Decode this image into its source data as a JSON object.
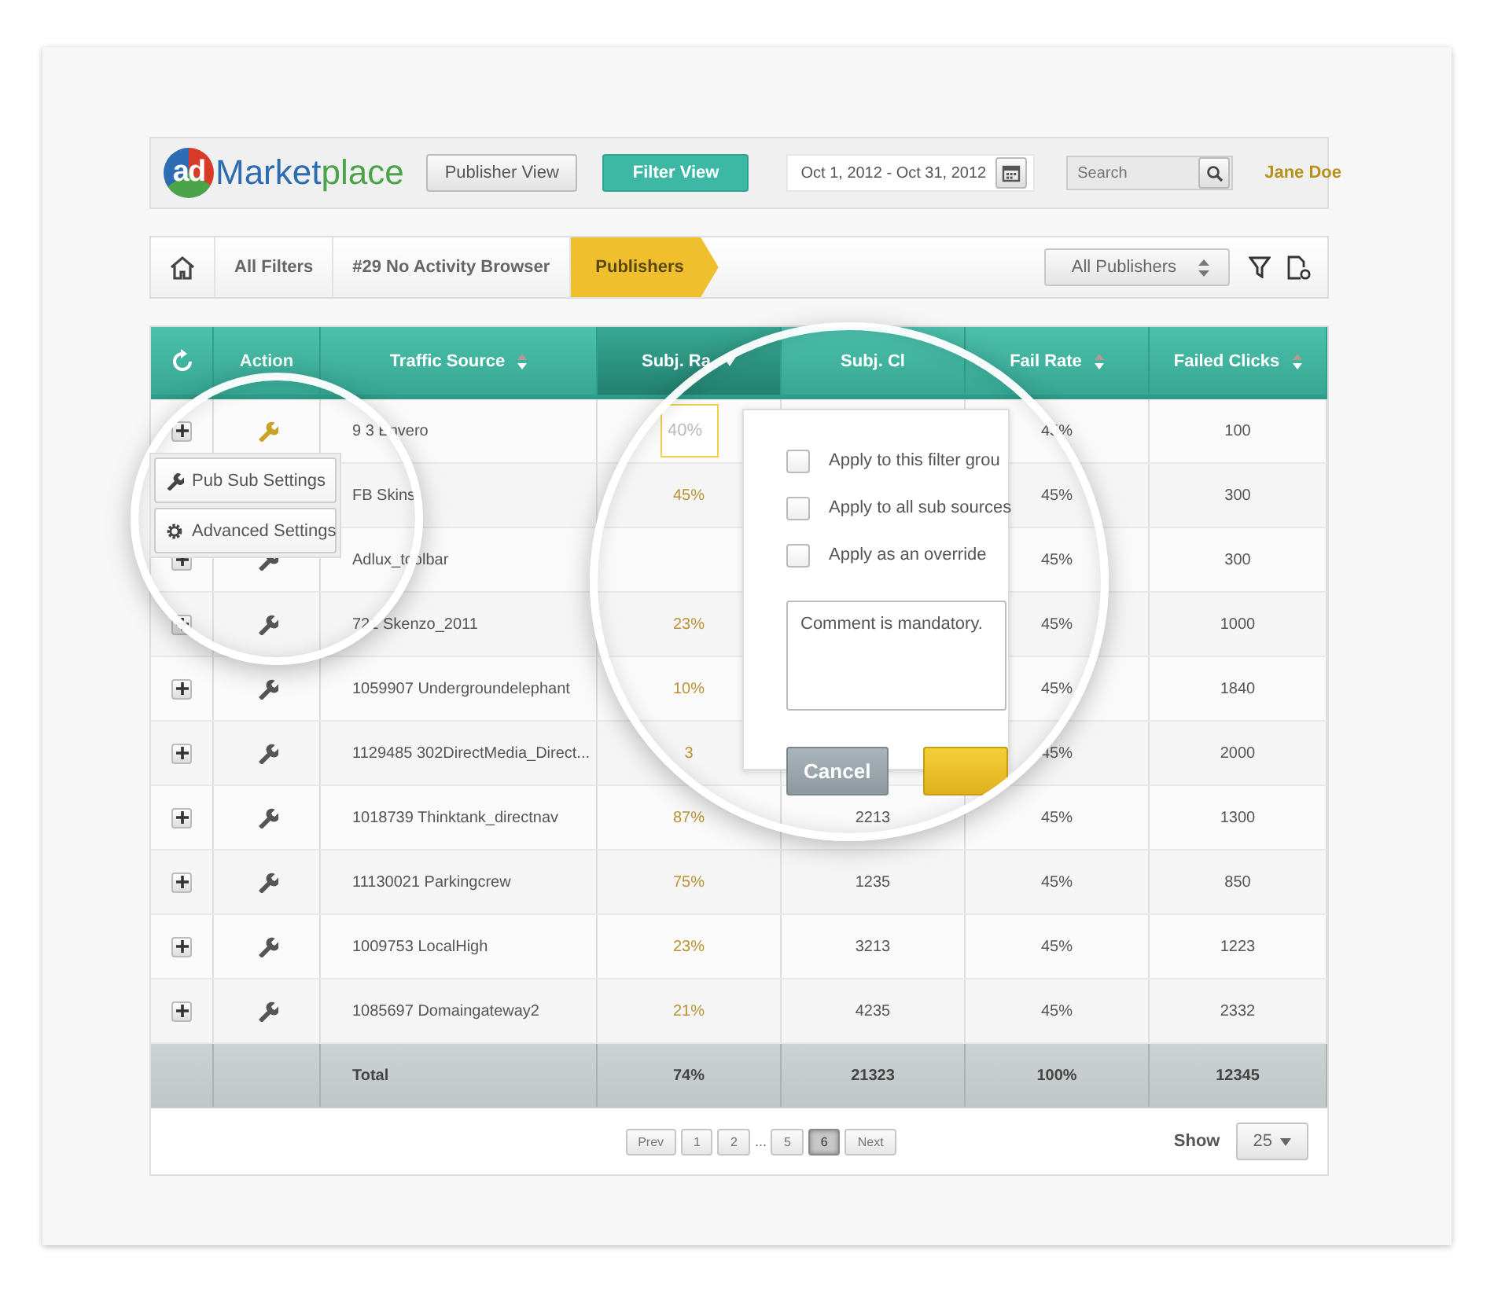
{
  "header": {
    "logo": {
      "badge": "ad",
      "text_1": "Market",
      "text_2": "place"
    },
    "views": [
      {
        "label": "Publisher View",
        "selected": false
      },
      {
        "label": "Filter View",
        "selected": true
      }
    ],
    "date_range": {
      "value": "Oct 1, 2012 - Oct 31, 2012"
    },
    "search": {
      "placeholder": "Search"
    },
    "user": "Jane Doe"
  },
  "breadcrumb": {
    "items": [
      {
        "label": "All Filters",
        "selected": false
      },
      {
        "label": "#29 No Activity Browser",
        "selected": false
      },
      {
        "label": "Publishers",
        "selected": true
      }
    ],
    "publisher_select": {
      "value": "All Publishers"
    }
  },
  "table": {
    "columns": [
      {
        "kind": "refresh",
        "sortable": false,
        "sorted": false
      },
      {
        "label": "Action",
        "sortable": false,
        "sorted": false
      },
      {
        "label": "Traffic Source",
        "sortable": true,
        "sorted": false
      },
      {
        "label": "Subj. Ra",
        "sortable": true,
        "sorted": true
      },
      {
        "label": "Subj. Cl",
        "sortable": false,
        "sorted": false
      },
      {
        "label": "Fail Rate",
        "sortable": true,
        "sorted": false
      },
      {
        "label": "Failed Clicks",
        "sortable": true,
        "sorted": false
      }
    ],
    "rows": [
      {
        "menu_open": true,
        "source": "9 3 Envero",
        "subj_rate_field": {
          "placeholder": "40%"
        },
        "fail_rate": "45%",
        "failed_clicks": "100"
      },
      {
        "menu_open": false,
        "source": "FB Skins",
        "subj_rate": "45%",
        "fail_rate": "45%",
        "failed_clicks": "300"
      },
      {
        "menu_open": false,
        "source": "Adlux_toolbar",
        "fail_rate": "45%",
        "failed_clicks": "300"
      },
      {
        "menu_open": false,
        "source": "721 Skenzo_2011",
        "subj_rate": "23%",
        "fail_rate": "45%",
        "failed_clicks": "1000"
      },
      {
        "menu_open": false,
        "source": "1059907 Undergroundelephant",
        "subj_rate": "10%",
        "fail_rate": "45%",
        "failed_clicks": "1840"
      },
      {
        "menu_open": false,
        "source": "1129485 302DirectMedia_Direct...",
        "subj_rate": "3",
        "fail_rate": "45%",
        "failed_clicks": "2000"
      },
      {
        "menu_open": false,
        "source": "1018739 Thinktank_directnav",
        "subj_rate": "87%",
        "subj_clicks": "2213",
        "fail_rate": "45%",
        "failed_clicks": "1300"
      },
      {
        "menu_open": false,
        "source": "11130021 Parkingcrew",
        "subj_rate": "75%",
        "subj_clicks": "1235",
        "fail_rate": "45%",
        "failed_clicks": "850"
      },
      {
        "menu_open": false,
        "source": "1009753 LocalHigh",
        "subj_rate": "23%",
        "subj_clicks": "3213",
        "fail_rate": "45%",
        "failed_clicks": "1223"
      },
      {
        "menu_open": false,
        "source": "1085697 Domaingateway2",
        "subj_rate": "21%",
        "subj_clicks": "4235",
        "fail_rate": "45%",
        "failed_clicks": "2332"
      }
    ],
    "total": {
      "label": "Total",
      "subj_rate": "74%",
      "subj_clicks": "21323",
      "fail_rate": "100%",
      "failed_clicks": "12345"
    }
  },
  "action_menu": {
    "items": [
      {
        "kind": "wrench",
        "label": "Pub Sub Settings"
      },
      {
        "kind": "gear",
        "label": "Advanced Settings"
      }
    ]
  },
  "rate_popup": {
    "options": [
      {
        "label": "Apply to this filter grou",
        "checked": false
      },
      {
        "label": "Apply to all sub sources",
        "checked": false
      },
      {
        "label": "Apply as an override",
        "checked": false
      }
    ],
    "comment": {
      "value": "Comment is mandatory."
    },
    "cancel": "Cancel"
  },
  "pagination": {
    "prev": "Prev",
    "pages": [
      {
        "label": "1",
        "selected": false
      },
      {
        "label": "2",
        "selected": false
      },
      {
        "label": "...",
        "kind": "gap"
      },
      {
        "label": "5",
        "selected": false
      },
      {
        "label": "6",
        "selected": true
      }
    ],
    "next": "Next",
    "show_label": "Show",
    "page_size": "25"
  }
}
